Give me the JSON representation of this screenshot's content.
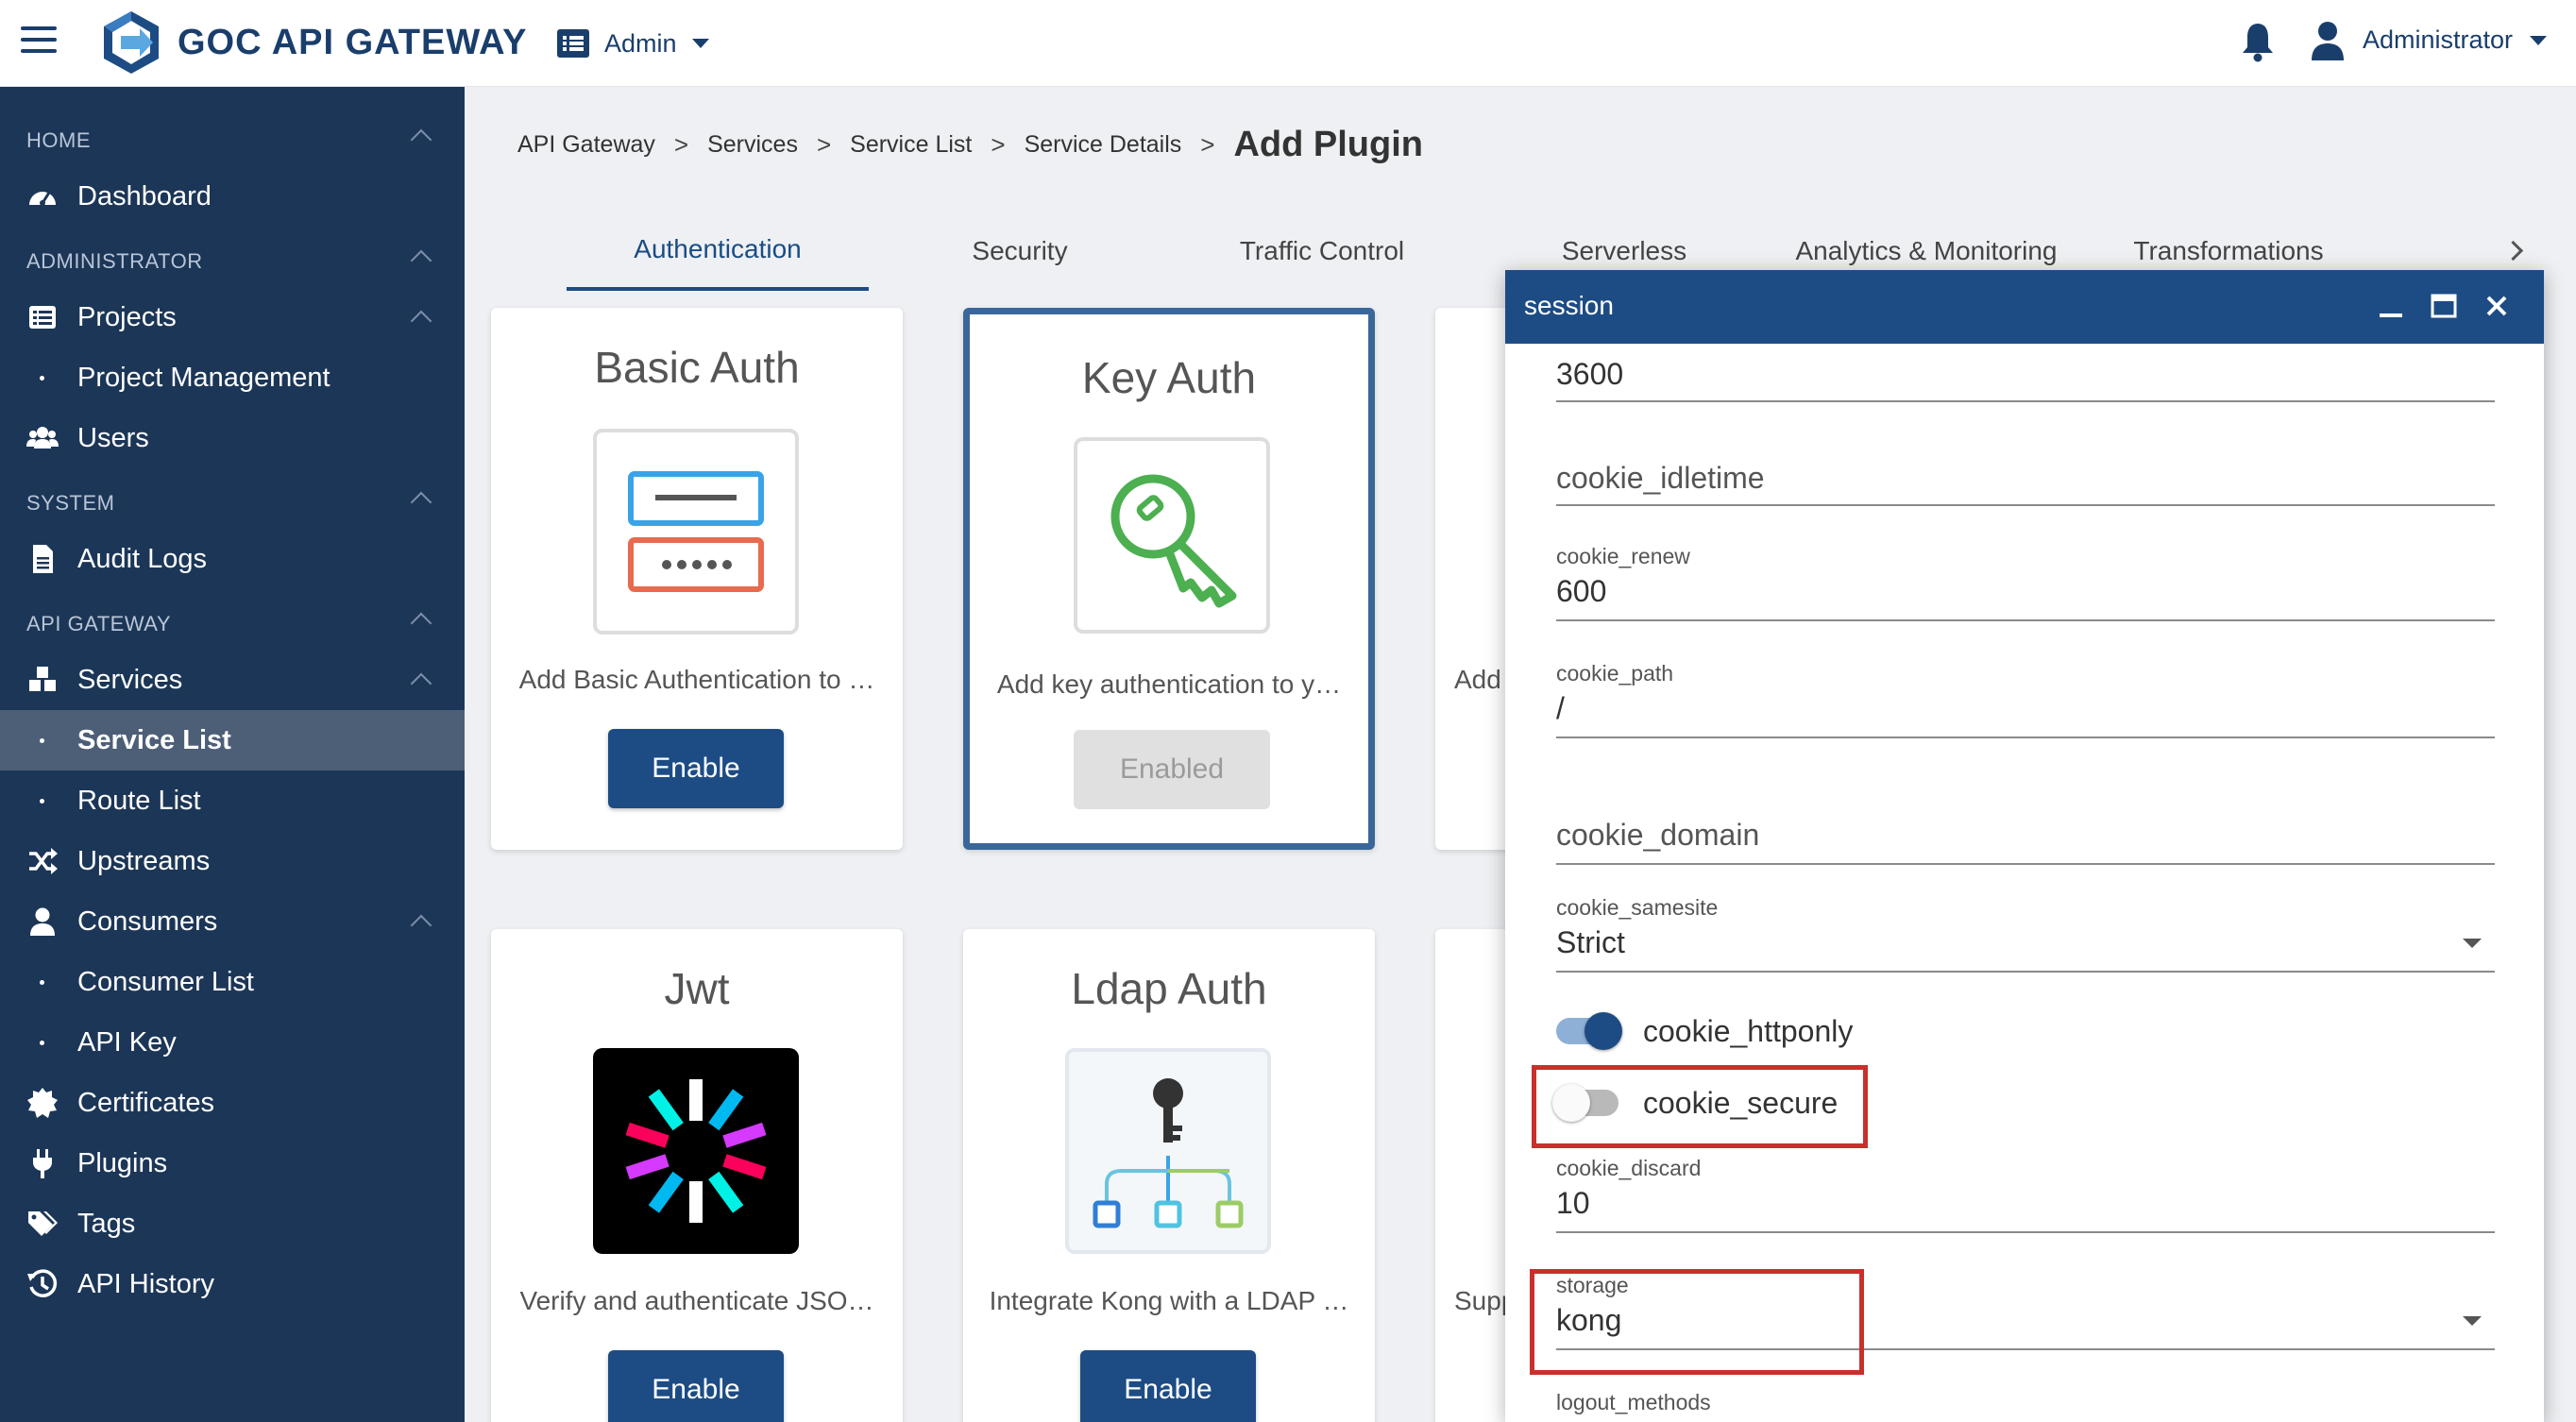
{
  "app": {
    "brand": "GOC API GATEWAY",
    "workspace": "Admin",
    "user": "Administrator"
  },
  "sidebar": {
    "sections": [
      {
        "label": "HOME"
      },
      {
        "label": "ADMINISTRATOR"
      },
      {
        "label": "SYSTEM"
      },
      {
        "label": "API GATEWAY"
      }
    ],
    "items": [
      {
        "label": "Dashboard"
      },
      {
        "label": "Projects"
      },
      {
        "label": "Project Management"
      },
      {
        "label": "Users"
      },
      {
        "label": "Audit Logs"
      },
      {
        "label": "Services"
      },
      {
        "label": "Service List"
      },
      {
        "label": "Route List"
      },
      {
        "label": "Upstreams"
      },
      {
        "label": "Consumers"
      },
      {
        "label": "Consumer List"
      },
      {
        "label": "API Key"
      },
      {
        "label": "Certificates"
      },
      {
        "label": "Plugins"
      },
      {
        "label": "Tags"
      },
      {
        "label": "API History"
      }
    ]
  },
  "breadcrumb": {
    "items": [
      "API Gateway",
      "Services",
      "Service List",
      "Service Details"
    ],
    "separator": ">",
    "current": "Add Plugin"
  },
  "tabs": [
    {
      "label": "Authentication"
    },
    {
      "label": "Security"
    },
    {
      "label": "Traffic Control"
    },
    {
      "label": "Serverless"
    },
    {
      "label": "Analytics & Monitoring"
    },
    {
      "label": "Transformations"
    }
  ],
  "cards": [
    {
      "title": "Basic Auth",
      "desc": "Add Basic Authentication to …",
      "button": "Enable"
    },
    {
      "title": "Key Auth",
      "desc": "Add key authentication to y…",
      "button": "Enabled"
    },
    {
      "title": "Jwt",
      "desc": "Verify and authenticate JSO…",
      "button": "Enable"
    },
    {
      "title": "Ldap Auth",
      "desc": "Integrate Kong with a LDAP …",
      "button": "Enable"
    }
  ],
  "peek_cards": [
    {
      "text": "Add"
    },
    {
      "text": "Supp"
    }
  ],
  "dialog": {
    "title": "session",
    "fields": {
      "cookie_lifetime_value": "3600",
      "cookie_idletime_label": "cookie_idletime",
      "cookie_renew_label": "cookie_renew",
      "cookie_renew_value": "600",
      "cookie_path_label": "cookie_path",
      "cookie_path_value": "/",
      "cookie_domain_label": "cookie_domain",
      "cookie_samesite_label": "cookie_samesite",
      "cookie_samesite_value": "Strict",
      "cookie_httponly_label": "cookie_httponly",
      "cookie_secure_label": "cookie_secure",
      "cookie_discard_label": "cookie_discard",
      "cookie_discard_value": "10",
      "storage_label": "storage",
      "storage_value": "kong",
      "logout_methods_label": "logout_methods"
    },
    "toggles": {
      "cookie_httponly": true,
      "cookie_secure": false
    }
  },
  "colors": {
    "primary": "#1d4c84",
    "sidebar": "#1c3657",
    "highlight": "#c9302c"
  }
}
